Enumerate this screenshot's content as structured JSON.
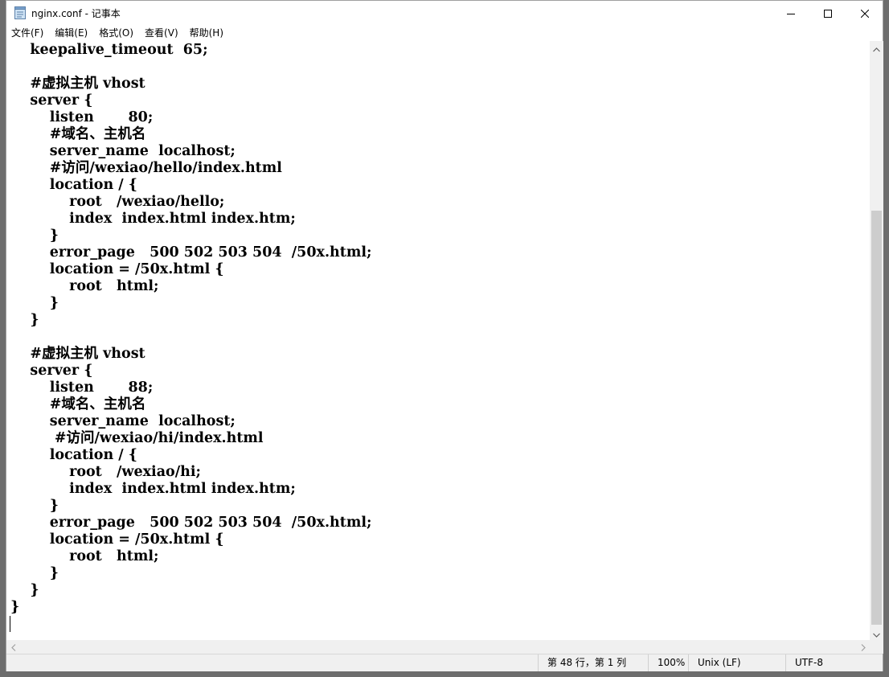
{
  "window": {
    "title": "nginx.conf - 记事本",
    "app_icon": "notepad-icon"
  },
  "menu": [
    {
      "label": "文件(F)"
    },
    {
      "label": "编辑(E)"
    },
    {
      "label": "格式(O)"
    },
    {
      "label": "查看(V)"
    },
    {
      "label": "帮助(H)"
    }
  ],
  "editor": {
    "lines": [
      "    keepalive_timeout  65;",
      "",
      "    #虚拟主机 vhost",
      "    server {",
      "        listen       80;",
      "        #域名、主机名",
      "        server_name  localhost;",
      "        #访问/wexiao/hello/index.html",
      "        location / {",
      "            root   /wexiao/hello;",
      "            index  index.html index.htm;",
      "        }",
      "        error_page   500 502 503 504  /50x.html;",
      "        location = /50x.html {",
      "            root   html;",
      "        }",
      "    }",
      "",
      "    #虚拟主机 vhost",
      "    server {",
      "        listen       88;",
      "        #域名、主机名",
      "        server_name  localhost;",
      "         #访问/wexiao/hi/index.html",
      "        location / {",
      "            root   /wexiao/hi;",
      "            index  index.html index.htm;",
      "        }",
      "        error_page   500 502 503 504  /50x.html;",
      "        location = /50x.html {",
      "            root   html;",
      "        }",
      "    }",
      "}",
      ""
    ]
  },
  "status": {
    "position": "第 48 行，第 1 列",
    "zoom": "100%",
    "line_ending": "Unix (LF)",
    "encoding": "UTF-8"
  }
}
